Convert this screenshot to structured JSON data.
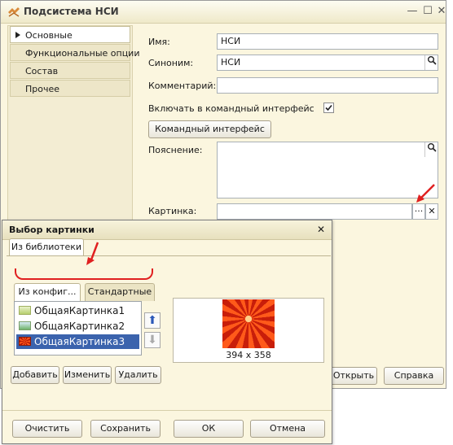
{
  "window": {
    "title": "Подсистема НСИ",
    "minimize": "—",
    "maximize": "☐",
    "close": "✕"
  },
  "nav": {
    "items": [
      "Основные",
      "Функциональные опции",
      "Состав",
      "Прочее"
    ]
  },
  "form": {
    "name_label": "Имя:",
    "name_value": "НСИ",
    "synonym_label": "Синоним:",
    "synonym_value": "НСИ",
    "comment_label": "Комментарий:",
    "comment_value": "",
    "include_label": "Включать в командный интерфейс",
    "include_checked": true,
    "cmd_button": "Командный интерфейс",
    "explanation_label": "Пояснение:",
    "picture_label": "Картинка:",
    "picture_value": "",
    "select_button": "...",
    "clear_button": "✕"
  },
  "footer": {
    "open_button": "Открыть",
    "help_button": "Справка"
  },
  "dialog": {
    "title": "Выбор картинки",
    "close": "✕",
    "tab_library": "Из библиотеки",
    "subtab_config": "Из конфиг...",
    "subtab_standard": "Стандартные",
    "pictures": [
      "ОбщаяКартинка1",
      "ОбщаяКартинка2",
      "ОбщаяКартинка3"
    ],
    "selected_index": 2,
    "move_up": "⬆",
    "move_down": "⬇",
    "add_button": "Добавить",
    "edit_button": "Изменить",
    "delete_button": "Удалить",
    "preview_size": "394 x 358",
    "clear_button": "Очистить",
    "save_button": "Сохранить",
    "ok_button": "ОК",
    "cancel_button": "Отмена"
  },
  "colors": {
    "accent": "#3b63ad",
    "annotation": "#e02020",
    "window_bg": "#fbf6df"
  }
}
